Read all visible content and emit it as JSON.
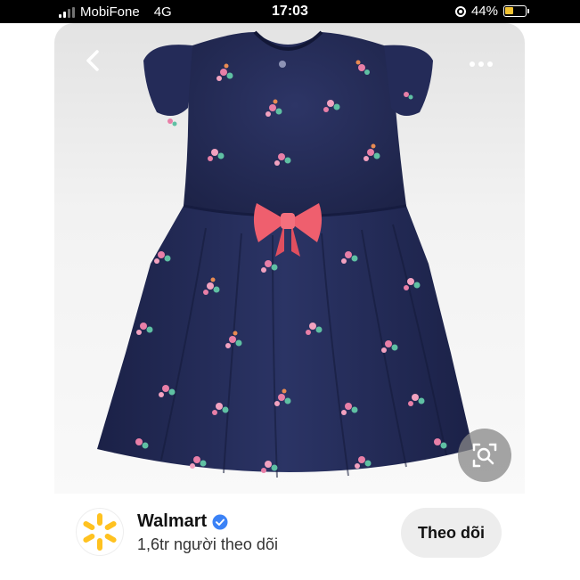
{
  "status_bar": {
    "carrier": "MobiFone",
    "network": "4G",
    "time": "17:03",
    "battery_percent": "44%",
    "battery_level": 0.44,
    "battery_color": "#f1c232"
  },
  "product_image": {
    "icons": {
      "back": "chevron-left-icon",
      "more": "more-horizontal-icon",
      "visual_search": "visual-search-icon"
    }
  },
  "profile": {
    "name": "Walmart",
    "verified": true,
    "followers": "1,6tr người theo dõi",
    "follow_label": "Theo dõi",
    "logo_color": "#ffc220",
    "verified_color": "#3b82f6"
  }
}
